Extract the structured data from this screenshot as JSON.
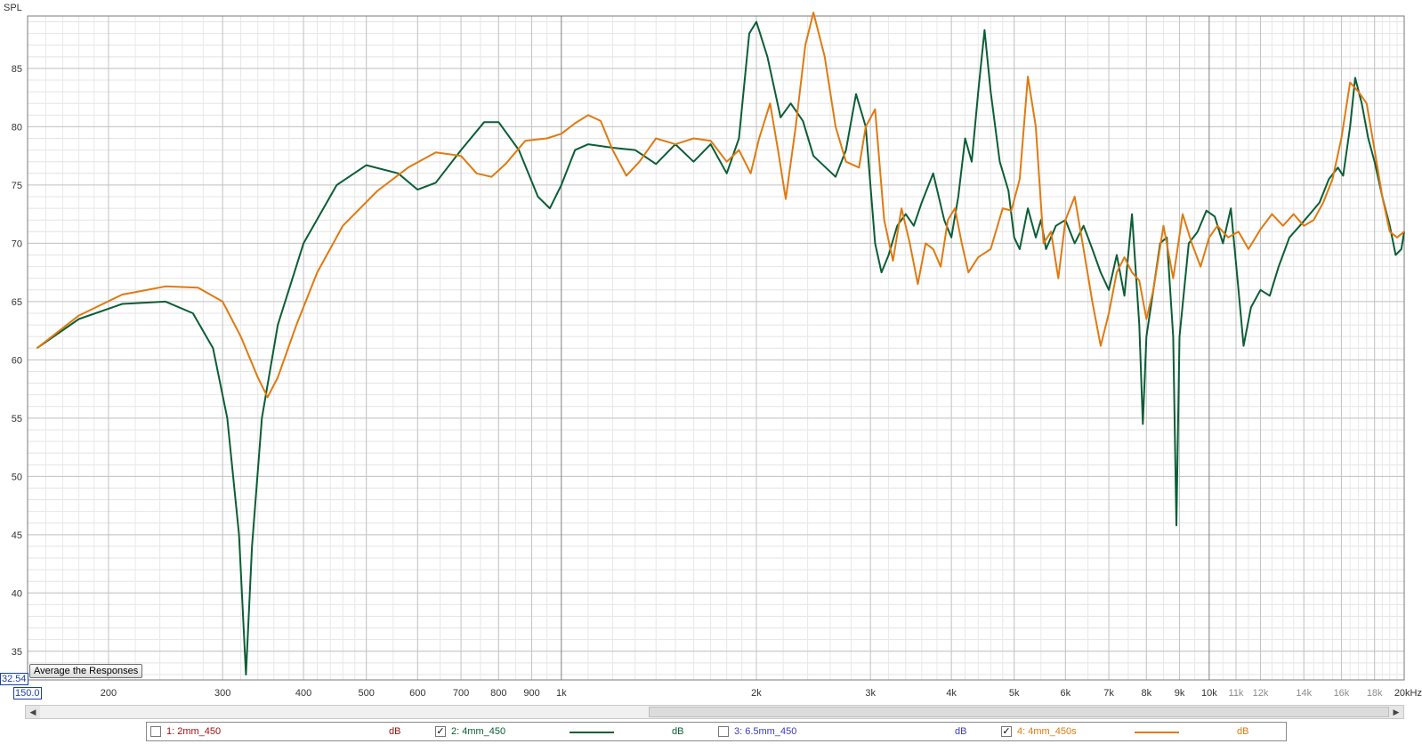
{
  "chart_data": {
    "type": "line",
    "ylabel": "SPL",
    "x_scale": "log",
    "xlim": [
      150,
      20000
    ],
    "ylim": [
      32.54,
      89.5
    ],
    "x_ticks": [
      {
        "v": 200,
        "label": "200"
      },
      {
        "v": 300,
        "label": "300"
      },
      {
        "v": 400,
        "label": "400"
      },
      {
        "v": 500,
        "label": "500"
      },
      {
        "v": 600,
        "label": "600"
      },
      {
        "v": 700,
        "label": "700"
      },
      {
        "v": 800,
        "label": "800"
      },
      {
        "v": 900,
        "label": "900"
      },
      {
        "v": 1000,
        "label": "1k"
      },
      {
        "v": 2000,
        "label": "2k"
      },
      {
        "v": 3000,
        "label": "3k"
      },
      {
        "v": 4000,
        "label": "4k"
      },
      {
        "v": 5000,
        "label": "5k"
      },
      {
        "v": 6000,
        "label": "6k"
      },
      {
        "v": 7000,
        "label": "7k"
      },
      {
        "v": 8000,
        "label": "8k"
      },
      {
        "v": 9000,
        "label": "9k"
      },
      {
        "v": 10000,
        "label": "10k"
      },
      {
        "v": 11000,
        "label": "11k"
      },
      {
        "v": 12000,
        "label": "12k"
      },
      {
        "v": 14000,
        "label": "14k"
      },
      {
        "v": 16000,
        "label": "16k"
      },
      {
        "v": 18000,
        "label": "18k"
      },
      {
        "v": 20000,
        "label": "20kHz"
      }
    ],
    "y_ticks": [
      35,
      40,
      45,
      50,
      55,
      60,
      65,
      70,
      75,
      80,
      85
    ],
    "x_min_label": "150.0",
    "y_min_label": "32.54",
    "grid": true,
    "series": [
      {
        "name": "2: 4mm_450",
        "color": "#0b5e35",
        "points": [
          [
            155,
            61
          ],
          [
            180,
            63.5
          ],
          [
            210,
            64.8
          ],
          [
            245,
            65
          ],
          [
            270,
            64
          ],
          [
            290,
            61
          ],
          [
            305,
            55
          ],
          [
            318,
            45
          ],
          [
            326,
            33
          ],
          [
            333,
            44
          ],
          [
            345,
            55
          ],
          [
            365,
            63
          ],
          [
            400,
            70
          ],
          [
            450,
            75
          ],
          [
            500,
            76.7
          ],
          [
            560,
            76
          ],
          [
            600,
            74.6
          ],
          [
            640,
            75.2
          ],
          [
            700,
            78
          ],
          [
            760,
            80.4
          ],
          [
            800,
            80.4
          ],
          [
            860,
            78
          ],
          [
            920,
            74
          ],
          [
            960,
            73
          ],
          [
            1000,
            75
          ],
          [
            1050,
            78
          ],
          [
            1100,
            78.5
          ],
          [
            1200,
            78.2
          ],
          [
            1300,
            78
          ],
          [
            1400,
            76.8
          ],
          [
            1500,
            78.5
          ],
          [
            1600,
            77
          ],
          [
            1700,
            78.5
          ],
          [
            1800,
            76
          ],
          [
            1880,
            79
          ],
          [
            1950,
            88
          ],
          [
            2000,
            89
          ],
          [
            2080,
            86
          ],
          [
            2180,
            80.8
          ],
          [
            2260,
            82
          ],
          [
            2360,
            80.5
          ],
          [
            2450,
            77.5
          ],
          [
            2560,
            76.5
          ],
          [
            2650,
            75.7
          ],
          [
            2750,
            78
          ],
          [
            2850,
            82.8
          ],
          [
            2950,
            80
          ],
          [
            3050,
            70
          ],
          [
            3120,
            67.5
          ],
          [
            3200,
            69
          ],
          [
            3300,
            71.5
          ],
          [
            3400,
            72.5
          ],
          [
            3500,
            71.5
          ],
          [
            3600,
            73.5
          ],
          [
            3750,
            76
          ],
          [
            3900,
            72
          ],
          [
            4000,
            70.5
          ],
          [
            4100,
            74
          ],
          [
            4200,
            79
          ],
          [
            4300,
            77
          ],
          [
            4400,
            83
          ],
          [
            4500,
            88.3
          ],
          [
            4600,
            83
          ],
          [
            4750,
            77
          ],
          [
            4900,
            74.5
          ],
          [
            5000,
            70.5
          ],
          [
            5100,
            69.5
          ],
          [
            5250,
            73
          ],
          [
            5400,
            70.5
          ],
          [
            5500,
            72
          ],
          [
            5600,
            69.5
          ],
          [
            5800,
            71.5
          ],
          [
            6000,
            72
          ],
          [
            6200,
            70
          ],
          [
            6400,
            71.5
          ],
          [
            6600,
            69.5
          ],
          [
            6800,
            67.5
          ],
          [
            7000,
            66
          ],
          [
            7200,
            69
          ],
          [
            7400,
            65.5
          ],
          [
            7600,
            72.5
          ],
          [
            7800,
            63
          ],
          [
            7900,
            54.5
          ],
          [
            8000,
            62
          ],
          [
            8200,
            66
          ],
          [
            8400,
            70
          ],
          [
            8600,
            70.5
          ],
          [
            8800,
            62
          ],
          [
            8900,
            45.8
          ],
          [
            9000,
            62
          ],
          [
            9300,
            70
          ],
          [
            9600,
            71
          ],
          [
            9900,
            72.8
          ],
          [
            10200,
            72.3
          ],
          [
            10500,
            70
          ],
          [
            10800,
            73
          ],
          [
            11100,
            66
          ],
          [
            11300,
            61.2
          ],
          [
            11600,
            64.5
          ],
          [
            12000,
            66
          ],
          [
            12400,
            65.5
          ],
          [
            12800,
            68
          ],
          [
            13300,
            70.5
          ],
          [
            13800,
            71.5
          ],
          [
            14300,
            72.5
          ],
          [
            14800,
            73.5
          ],
          [
            15300,
            75.5
          ],
          [
            15800,
            76.5
          ],
          [
            16100,
            75.8
          ],
          [
            16500,
            80
          ],
          [
            16800,
            84.2
          ],
          [
            17200,
            82
          ],
          [
            17600,
            79
          ],
          [
            18000,
            77
          ],
          [
            18500,
            74
          ],
          [
            19000,
            71.5
          ],
          [
            19400,
            69
          ],
          [
            19800,
            69.5
          ],
          [
            20000,
            71
          ]
        ]
      },
      {
        "name": "4: 4mm_450s",
        "color": "#e07a10",
        "points": [
          [
            155,
            61
          ],
          [
            180,
            63.8
          ],
          [
            210,
            65.6
          ],
          [
            245,
            66.3
          ],
          [
            275,
            66.2
          ],
          [
            300,
            65
          ],
          [
            320,
            62
          ],
          [
            340,
            58.5
          ],
          [
            352,
            56.8
          ],
          [
            365,
            58.5
          ],
          [
            390,
            63
          ],
          [
            420,
            67.5
          ],
          [
            460,
            71.5
          ],
          [
            520,
            74.5
          ],
          [
            580,
            76.5
          ],
          [
            640,
            77.8
          ],
          [
            700,
            77.5
          ],
          [
            740,
            76
          ],
          [
            780,
            75.7
          ],
          [
            820,
            76.8
          ],
          [
            880,
            78.8
          ],
          [
            950,
            79
          ],
          [
            1000,
            79.4
          ],
          [
            1050,
            80.3
          ],
          [
            1100,
            81
          ],
          [
            1150,
            80.5
          ],
          [
            1200,
            78
          ],
          [
            1260,
            75.8
          ],
          [
            1320,
            77
          ],
          [
            1400,
            79
          ],
          [
            1500,
            78.5
          ],
          [
            1600,
            79
          ],
          [
            1700,
            78.8
          ],
          [
            1800,
            77
          ],
          [
            1880,
            78
          ],
          [
            1960,
            76
          ],
          [
            2020,
            79
          ],
          [
            2100,
            82
          ],
          [
            2160,
            78
          ],
          [
            2220,
            73.8
          ],
          [
            2300,
            80
          ],
          [
            2380,
            87
          ],
          [
            2450,
            89.8
          ],
          [
            2550,
            86
          ],
          [
            2650,
            80
          ],
          [
            2750,
            77
          ],
          [
            2880,
            76.5
          ],
          [
            2950,
            80
          ],
          [
            3050,
            81.5
          ],
          [
            3150,
            72
          ],
          [
            3250,
            68.5
          ],
          [
            3350,
            73
          ],
          [
            3450,
            70
          ],
          [
            3550,
            66.5
          ],
          [
            3650,
            70
          ],
          [
            3750,
            69.5
          ],
          [
            3850,
            68
          ],
          [
            3950,
            72
          ],
          [
            4050,
            73
          ],
          [
            4150,
            70
          ],
          [
            4250,
            67.5
          ],
          [
            4400,
            68.8
          ],
          [
            4600,
            69.5
          ],
          [
            4800,
            73
          ],
          [
            4950,
            72.8
          ],
          [
            5100,
            75.5
          ],
          [
            5250,
            84.3
          ],
          [
            5400,
            80
          ],
          [
            5550,
            70
          ],
          [
            5700,
            71
          ],
          [
            5850,
            67
          ],
          [
            6000,
            72
          ],
          [
            6200,
            74
          ],
          [
            6400,
            69.5
          ],
          [
            6600,
            65
          ],
          [
            6800,
            61.2
          ],
          [
            7000,
            64
          ],
          [
            7200,
            67.5
          ],
          [
            7400,
            68.8
          ],
          [
            7600,
            67.5
          ],
          [
            7800,
            66.8
          ],
          [
            8000,
            63.5
          ],
          [
            8200,
            66
          ],
          [
            8500,
            71.5
          ],
          [
            8800,
            67
          ],
          [
            9100,
            72.5
          ],
          [
            9400,
            70
          ],
          [
            9700,
            68
          ],
          [
            10000,
            70.5
          ],
          [
            10300,
            71.5
          ],
          [
            10700,
            70.5
          ],
          [
            11100,
            71
          ],
          [
            11500,
            69.5
          ],
          [
            12000,
            71.2
          ],
          [
            12500,
            72.5
          ],
          [
            13000,
            71.5
          ],
          [
            13500,
            72.5
          ],
          [
            14000,
            71.5
          ],
          [
            14500,
            72
          ],
          [
            15000,
            73.5
          ],
          [
            15500,
            75.5
          ],
          [
            16000,
            79
          ],
          [
            16500,
            83.8
          ],
          [
            17000,
            83
          ],
          [
            17500,
            82
          ],
          [
            18000,
            78
          ],
          [
            18500,
            74
          ],
          [
            19000,
            71
          ],
          [
            19500,
            70.5
          ],
          [
            20000,
            71
          ]
        ]
      }
    ]
  },
  "controls": {
    "average_button_label": "Average the Responses"
  },
  "legend": {
    "items": [
      {
        "label": "1: 2mm_450",
        "checked": false,
        "color": "#a01010",
        "unit": "dB",
        "checkmark": ""
      },
      {
        "label": "2: 4mm_450",
        "checked": true,
        "color": "#0b5e35",
        "unit": "dB",
        "checkmark": "✓"
      },
      {
        "label": "3: 6.5mm_450",
        "checked": false,
        "color": "#3a3ac0",
        "unit": "dB",
        "checkmark": ""
      },
      {
        "label": "4: 4mm_450s",
        "checked": true,
        "color": "#e07a10",
        "unit": "dB",
        "checkmark": "✓"
      }
    ]
  }
}
